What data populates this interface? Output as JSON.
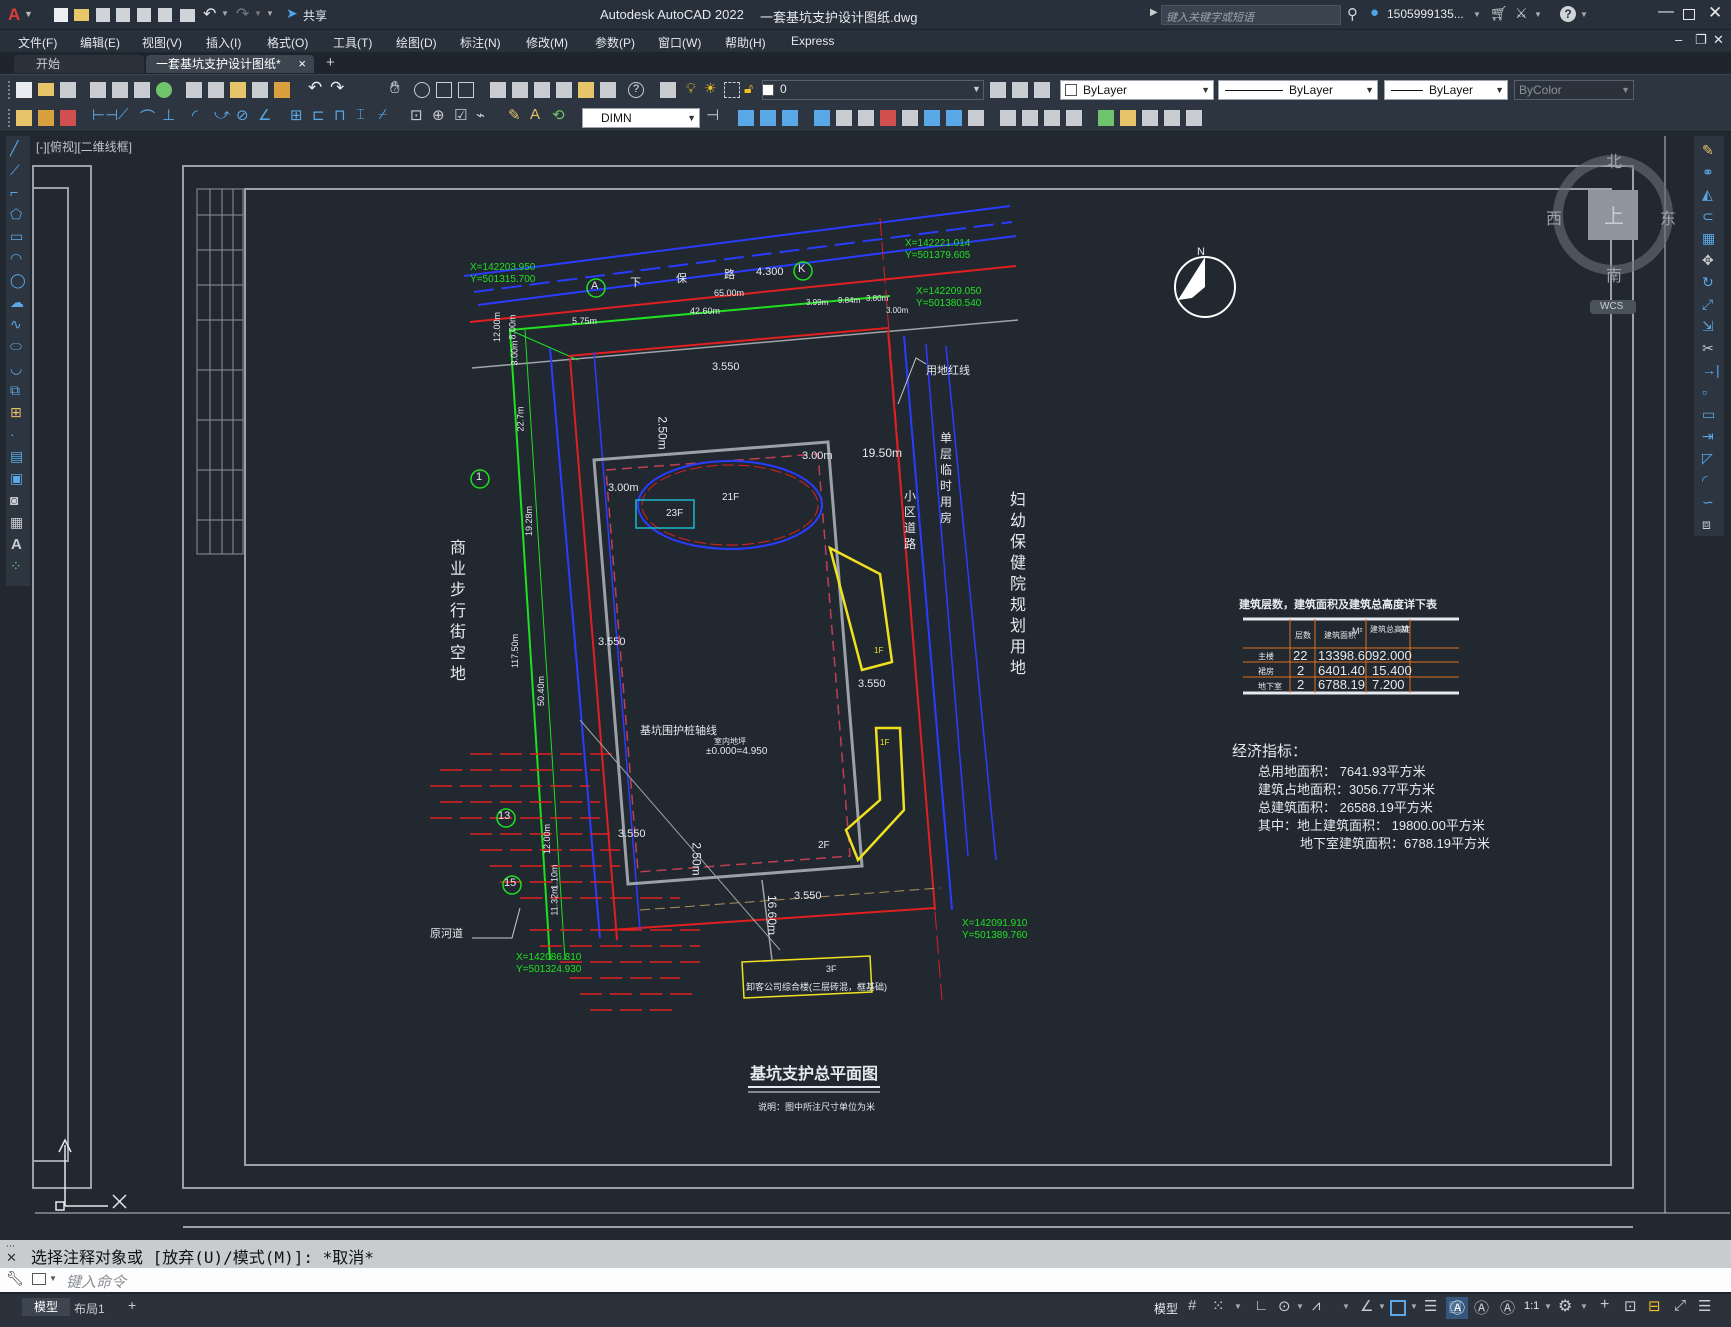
{
  "app": {
    "title": "Autodesk AutoCAD 2022",
    "file": "一套基坑支护设计图纸.dwg",
    "share": "共享",
    "search_placeholder": "键入关键字或短语",
    "user": "1505999135...",
    "help": "?"
  },
  "menu": [
    "文件(F)",
    "编辑(E)",
    "视图(V)",
    "插入(I)",
    "格式(O)",
    "工具(T)",
    "绘图(D)",
    "标注(N)",
    "修改(M)",
    "参数(P)",
    "窗口(W)",
    "帮助(H)",
    "Express"
  ],
  "tabs": {
    "start": "开始",
    "drawing": "一套基坑支护设计图纸*",
    "close": "×",
    "add": "+"
  },
  "toolbar": {
    "layer": "0",
    "color": "ByLayer",
    "linetype": "ByLayer",
    "lineweight": "ByLayer",
    "plotstyle": "ByColor",
    "dimstyle": "DIMN"
  },
  "viewport_label": "[-][俯视][二维线框]",
  "viewcube": {
    "north": "北",
    "south": "南",
    "east": "东",
    "west": "西",
    "top": "上",
    "wcs": "WCS"
  },
  "drawing": {
    "title": "基坑支护总平面图",
    "note": "说明：图中所注尺寸单位为米",
    "north_label": "N",
    "left_land": "商业步行街空地",
    "right_land": "妇幼保健院规划用地",
    "temp_house": "单层临时用房",
    "road": "小区道路",
    "top_road": [
      "下",
      "保",
      "路"
    ],
    "top_elev": "4.300",
    "red_line": "用地红线",
    "original_river": "原河道",
    "pit_line": "基坑围护桩轴线",
    "datum": "室内地坪",
    "elev_datum": "±0.000=4.950",
    "south_building": "卸客公司综合楼(三层砖混，框基础)",
    "south_building_floors": "3F",
    "floors": {
      "main": "21F",
      "sub": "23F",
      "east1": "1F",
      "east2": "1F",
      "south": "2F"
    },
    "axis_labels": {
      "a": "A",
      "k": "K",
      "n1": "1",
      "n13": "13",
      "n15": "15"
    },
    "coords": [
      [
        "X=142203.950",
        "Y=501315.700"
      ],
      [
        "X=142221.014",
        "Y=501379.605"
      ],
      [
        "X=142209.050",
        "Y=501380.540"
      ],
      [
        "X=142086.810",
        "Y=501324.930"
      ],
      [
        "X=142091.910",
        "Y=501389.760"
      ]
    ],
    "elevations": [
      "3.550",
      "3.550",
      "3.550",
      "3.550",
      "3.550",
      "3.550"
    ],
    "dims": {
      "top_total": "65.00m",
      "top_inner": "42.60m",
      "d1": "5.75m",
      "d2": "3.99m",
      "d3": "9.84m",
      "d4": "3.80m",
      "d5": "3.00m",
      "left1": "12.00m",
      "left2": "8.00m",
      "left3": "3.00m",
      "left4": "22.7m",
      "left5": "19.28m",
      "left6": "117.50m",
      "left7": "50.40m",
      "left8": "12.00m",
      "left9": "1.10m",
      "left10": "11.32m",
      "right1": "19.50m",
      "pit1": "3.00m",
      "pit2": "3.00m",
      "pit3": "2.50m",
      "pit4": "2.50m",
      "bottom": "16.60m"
    }
  },
  "table": {
    "title": "建筑层数，建筑面积及建筑总高度详下表",
    "headers": [
      "",
      "层数",
      "建筑面积",
      "建筑总高度"
    ],
    "units": [
      "",
      "",
      "M²",
      "M"
    ],
    "rows": [
      [
        "主楼",
        "22",
        "13398.60",
        "92.000"
      ],
      [
        "裙房",
        "2",
        "6401.40",
        "15.400"
      ],
      [
        "地下室",
        "2",
        "6788.19",
        "7.200"
      ]
    ]
  },
  "indicators": {
    "title": "经济指标：",
    "lines": [
      "总用地面积：   7641.93平方米",
      "建筑占地面积：3056.77平方米",
      "总建筑面积：  26588.19平方米",
      "其中：地上建筑面积：  19800.00平方米",
      "地下室建筑面积：6788.19平方米"
    ]
  },
  "command": {
    "history": "选择注释对象或 [放弃(U)/模式(M)]: *取消*",
    "placeholder": "键入命令"
  },
  "status": {
    "model": "模型",
    "layout": "布局1",
    "add": "+",
    "model_btn": "模型",
    "scale": "1:1"
  }
}
